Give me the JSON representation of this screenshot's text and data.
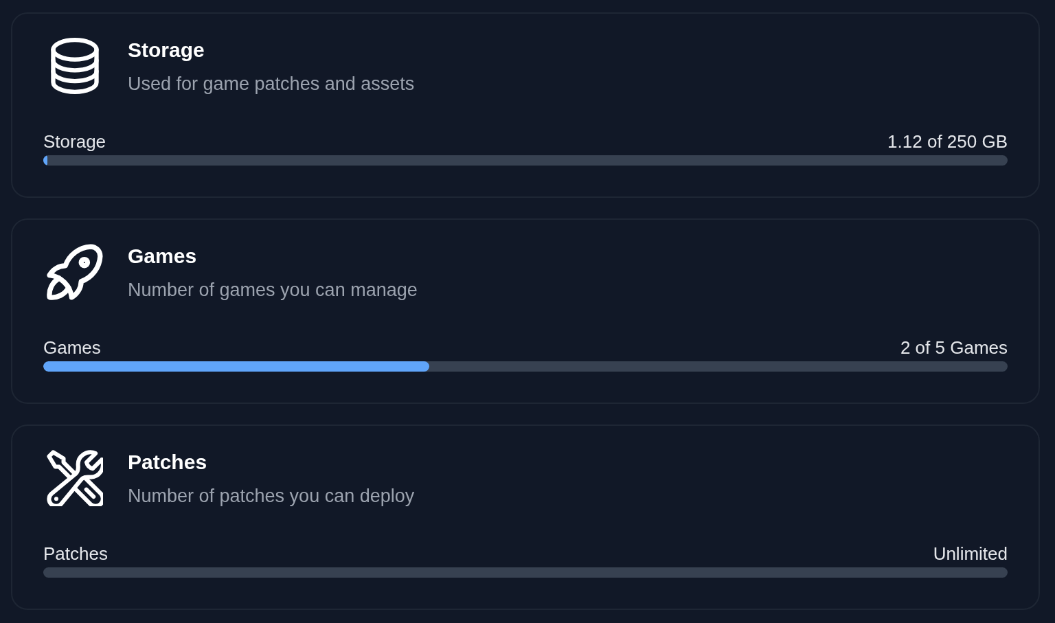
{
  "cards": [
    {
      "kind": "storage",
      "title": "Storage",
      "description": "Used for game patches and assets",
      "meter": {
        "label": "Storage",
        "reading": "1.12 of 250 GB",
        "level": 0.0045
      }
    },
    {
      "kind": "games",
      "title": "Games",
      "description": "Number of games you can manage",
      "meter": {
        "label": "Games",
        "reading": "2 of 5 Games",
        "level": 0.4
      }
    },
    {
      "kind": "patches",
      "title": "Patches",
      "description": "Number of patches you can deploy",
      "meter": {
        "label": "Patches",
        "reading": "Unlimited"
      }
    }
  ]
}
